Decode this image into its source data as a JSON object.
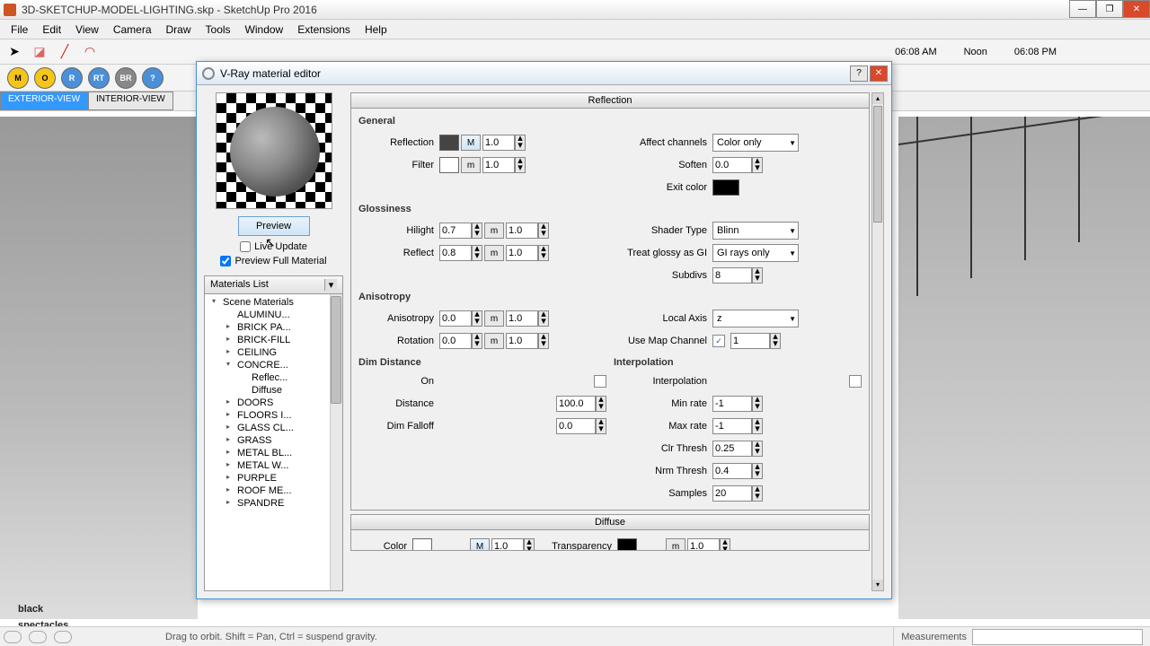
{
  "app": {
    "title": "3D-SKETCHUP-MODEL-LIGHTING.skp - SketchUp Pro 2016"
  },
  "menu": [
    "File",
    "Edit",
    "View",
    "Camera",
    "Draw",
    "Tools",
    "Window",
    "Extensions",
    "Help"
  ],
  "sun": {
    "am": "06:08 AM",
    "noon": "Noon",
    "pm": "06:08 PM"
  },
  "vray_icons": [
    "M",
    "O",
    "R",
    "RT",
    "BR",
    "?"
  ],
  "scene_tabs": {
    "active": "EXTERIOR-VIEW",
    "other": "INTERIOR-VIEW"
  },
  "vray": {
    "title": "V-Ray material editor",
    "preview_btn": "Preview",
    "live_update": "Live Update",
    "preview_full": "Preview Full Material",
    "mat_header": "Materials List",
    "tree": {
      "root": "Scene Materials",
      "items": [
        "ALUMINU...",
        "BRICK PA...",
        "BRICK-FILL",
        "CEILING",
        "CONCRE...",
        "DOORS",
        "FLOORS I...",
        "GLASS CL...",
        "GRASS",
        "METAL BL...",
        "METAL W...",
        "PURPLE",
        "ROOF ME...",
        "SPANDRE"
      ],
      "sub": [
        "Reflec...",
        "Diffuse"
      ]
    },
    "panels": {
      "reflection": {
        "title": "Reflection",
        "general": {
          "label": "General",
          "reflection": "Reflection",
          "reflection_val": "1.0",
          "filter": "Filter",
          "filter_val": "1.0",
          "affect_channels": "Affect channels",
          "affect_val": "Color only",
          "soften": "Soften",
          "soften_val": "0.0",
          "exit_color": "Exit color"
        },
        "glossiness": {
          "label": "Glossiness",
          "hilight": "Hilight",
          "hilight_val": "0.7",
          "hilight_val2": "1.0",
          "reflect": "Reflect",
          "reflect_val": "0.8",
          "reflect_val2": "1.0",
          "shader_type": "Shader Type",
          "shader_val": "Blinn",
          "treat_glossy": "Treat glossy as GI",
          "treat_val": "GI rays only",
          "subdivs": "Subdivs",
          "subdivs_val": "8"
        },
        "anisotropy": {
          "label": "Anisotropy",
          "anisotropy": "Anisotropy",
          "anisotropy_val": "0.0",
          "anisotropy_val2": "1.0",
          "rotation": "Rotation",
          "rotation_val": "0.0",
          "rotation_val2": "1.0",
          "local_axis": "Local Axis",
          "local_axis_val": "z",
          "use_map": "Use Map Channel",
          "use_map_val": "1"
        },
        "dim": {
          "label": "Dim Distance",
          "on": "On",
          "distance": "Distance",
          "distance_val": "100.0",
          "dim_falloff": "Dim Falloff",
          "dim_falloff_val": "0.0"
        },
        "interp": {
          "label": "Interpolation",
          "interpolation": "Interpolation",
          "min_rate": "Min rate",
          "min_rate_val": "-1",
          "max_rate": "Max rate",
          "max_rate_val": "-1",
          "clr_thresh": "Clr Thresh",
          "clr_thresh_val": "0.25",
          "nrm_thresh": "Nrm Thresh",
          "nrm_thresh_val": "0.4",
          "samples": "Samples",
          "samples_val": "20"
        }
      },
      "diffuse": {
        "title": "Diffuse",
        "color": "Color",
        "color_val": "1.0",
        "transparency": "Transparency",
        "trans_val": "1.0"
      }
    }
  },
  "status": {
    "hint": "Drag to orbit. Shift = Pan, Ctrl = suspend gravity.",
    "measurements": "Measurements"
  },
  "logo": {
    "l1": "black",
    "l2": "spectacles"
  }
}
